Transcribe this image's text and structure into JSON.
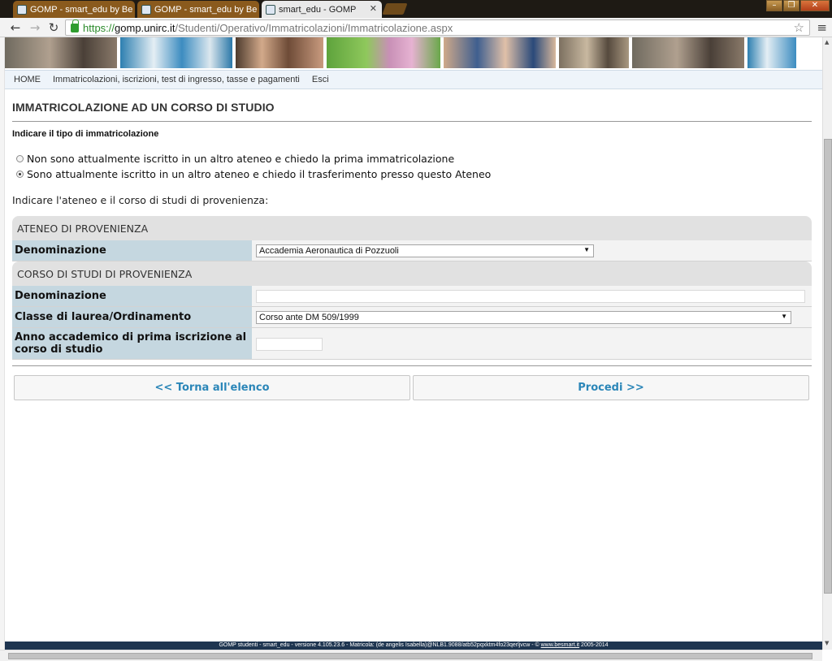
{
  "browser": {
    "tabs": [
      {
        "label": "GOMP - smart_edu by Be",
        "active": false
      },
      {
        "label": "GOMP - smart_edu by Be",
        "active": false
      },
      {
        "label": "smart_edu - GOMP",
        "active": true
      }
    ],
    "url": {
      "scheme": "https://",
      "host": "gomp.unirc.it",
      "path": "/Studenti/Operativo/Immatricolazioni/Immatricolazione.aspx"
    },
    "window_buttons": [
      "minimize",
      "restore",
      "close"
    ]
  },
  "nav": {
    "items": [
      "HOME",
      "Immatricolazioni, iscrizioni, test di ingresso, tasse e pagamenti",
      "Esci"
    ]
  },
  "page": {
    "title": "IMMATRICOLAZIONE AD UN CORSO DI STUDIO",
    "subtitle": "Indicare il tipo di immatricolazione",
    "radio_options": [
      {
        "label": "Non sono attualmente iscritto in un altro ateneo e chiedo la prima immatricolazione",
        "checked": false
      },
      {
        "label": "Sono attualmente iscritto in un altro ateneo e chiedo il trasferimento presso questo Ateneo",
        "checked": true
      }
    ],
    "intro": "Indicare l'ateneo e il corso di studi di provenienza:"
  },
  "ateneo": {
    "header": "ATENEO DI PROVENIENZA",
    "denominazione_label": "Denominazione",
    "denominazione_value": "Accademia Aeronautica di Pozzuoli"
  },
  "corso": {
    "header": "CORSO DI STUDI DI PROVENIENZA",
    "denominazione_label": "Denominazione",
    "denominazione_value": "",
    "classe_label": "Classe di laurea/Ordinamento",
    "classe_value": "Corso ante DM 509/1999",
    "anno_label_line1": "Anno accademico di prima iscrizione al",
    "anno_label_line2": "corso di studio",
    "anno_value": ""
  },
  "buttons": {
    "back": "<< Torna all'elenco",
    "next": "Procedi >>"
  },
  "footer": {
    "text": "GOMP studenti - smart_edu - versione 4.105.23.6 - Matricola: (de angelis Isabella)@NLB1.9088/atb52pqxktm4fo23qerljvcw - ©",
    "link": "www.besmart.it",
    "years": "2005-2014"
  },
  "colors": {
    "label_bg": "#c5d7e0",
    "button_text": "#2b86b8",
    "footer_bg": "#1e3550",
    "nav_bg": "#eef4fa"
  }
}
